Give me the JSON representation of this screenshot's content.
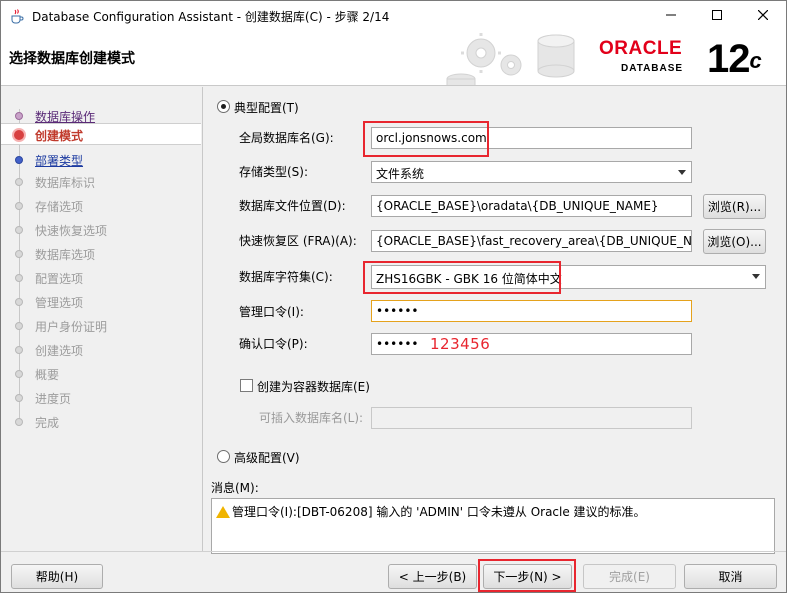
{
  "window": {
    "title": "Database Configuration Assistant - 创建数据库(C) - 步骤 2/14"
  },
  "banner": {
    "title": "选择数据库创建模式",
    "brand": "ORACLE",
    "product": "DATABASE",
    "version": "12",
    "version_suffix": "c"
  },
  "nav": {
    "items": [
      {
        "label": "数据库操作",
        "state": "done"
      },
      {
        "label": "创建模式",
        "state": "current"
      },
      {
        "label": "部署类型",
        "state": "link"
      },
      {
        "label": "数据库标识",
        "state": "pending"
      },
      {
        "label": "存储选项",
        "state": "pending"
      },
      {
        "label": "快速恢复选项",
        "state": "pending"
      },
      {
        "label": "数据库选项",
        "state": "pending"
      },
      {
        "label": "配置选项",
        "state": "pending"
      },
      {
        "label": "管理选项",
        "state": "pending"
      },
      {
        "label": "用户身份证明",
        "state": "pending"
      },
      {
        "label": "创建选项",
        "state": "pending"
      },
      {
        "label": "概要",
        "state": "pending"
      },
      {
        "label": "进度页",
        "state": "pending"
      },
      {
        "label": "完成",
        "state": "pending"
      }
    ]
  },
  "form": {
    "typical_label": "典型配置(T)",
    "typical_selected": true,
    "global_db_name_label": "全局数据库名(G):",
    "global_db_name_value": "orcl.jonsnows.com",
    "storage_type_label": "存储类型(S):",
    "storage_type_value": "文件系统",
    "db_file_location_label": "数据库文件位置(D):",
    "db_file_location_value": "{ORACLE_BASE}\\oradata\\{DB_UNIQUE_NAME}",
    "browse1_label": "浏览(R)...",
    "fra_label": "快速恢复区 (FRA)(A):",
    "fra_value": "{ORACLE_BASE}\\fast_recovery_area\\{DB_UNIQUE_NAME}",
    "browse2_label": "浏览(O)...",
    "charset_label": "数据库字符集(C):",
    "charset_value": "ZHS16GBK - GBK 16 位简体中文",
    "admin_pwd_label": "管理口令(I):",
    "admin_pwd_value": "••••••",
    "confirm_pwd_label": "确认口令(P):",
    "confirm_pwd_value": "••••••",
    "password_annotation": "123456",
    "container_db_label": "创建为容器数据库(E)",
    "container_db_checked": false,
    "pdb_name_label": "可插入数据库名(L):",
    "pdb_name_value": "",
    "advanced_label": "高级配置(V)",
    "advanced_selected": false
  },
  "messages": {
    "label": "消息(M):",
    "text": "管理口令(I):[DBT-06208] 输入的 'ADMIN' 口令未遵从 Oracle 建议的标准。"
  },
  "footer": {
    "help_label": "帮助(H)",
    "back_label": "< 上一步(B)",
    "next_label": "下一步(N) >",
    "finish_label": "完成(E)",
    "cancel_label": "取消"
  },
  "colors": {
    "oracle_red": "#e2001a",
    "highlight_red": "#e8262f",
    "current_step": "#c0392b",
    "link_blue": "#1c3aa0"
  }
}
